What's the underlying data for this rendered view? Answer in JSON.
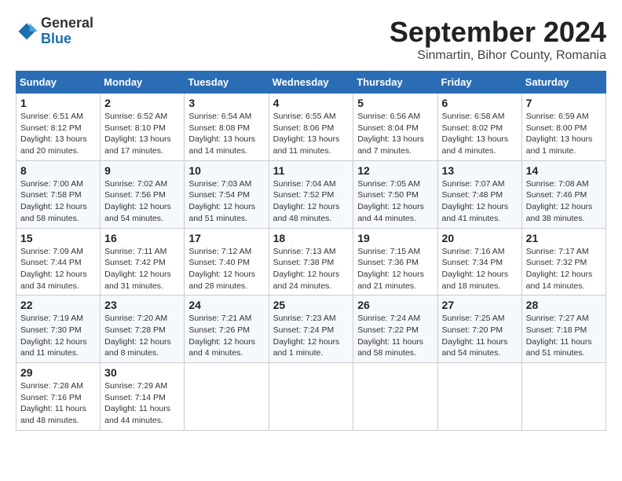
{
  "header": {
    "logo_general": "General",
    "logo_blue": "Blue",
    "month_title": "September 2024",
    "subtitle": "Sinmartin, Bihor County, Romania"
  },
  "days_of_week": [
    "Sunday",
    "Monday",
    "Tuesday",
    "Wednesday",
    "Thursday",
    "Friday",
    "Saturday"
  ],
  "weeks": [
    [
      {
        "day": "1",
        "info": "Sunrise: 6:51 AM\nSunset: 8:12 PM\nDaylight: 13 hours and 20 minutes."
      },
      {
        "day": "2",
        "info": "Sunrise: 6:52 AM\nSunset: 8:10 PM\nDaylight: 13 hours and 17 minutes."
      },
      {
        "day": "3",
        "info": "Sunrise: 6:54 AM\nSunset: 8:08 PM\nDaylight: 13 hours and 14 minutes."
      },
      {
        "day": "4",
        "info": "Sunrise: 6:55 AM\nSunset: 8:06 PM\nDaylight: 13 hours and 11 minutes."
      },
      {
        "day": "5",
        "info": "Sunrise: 6:56 AM\nSunset: 8:04 PM\nDaylight: 13 hours and 7 minutes."
      },
      {
        "day": "6",
        "info": "Sunrise: 6:58 AM\nSunset: 8:02 PM\nDaylight: 13 hours and 4 minutes."
      },
      {
        "day": "7",
        "info": "Sunrise: 6:59 AM\nSunset: 8:00 PM\nDaylight: 13 hours and 1 minute."
      }
    ],
    [
      {
        "day": "8",
        "info": "Sunrise: 7:00 AM\nSunset: 7:58 PM\nDaylight: 12 hours and 58 minutes."
      },
      {
        "day": "9",
        "info": "Sunrise: 7:02 AM\nSunset: 7:56 PM\nDaylight: 12 hours and 54 minutes."
      },
      {
        "day": "10",
        "info": "Sunrise: 7:03 AM\nSunset: 7:54 PM\nDaylight: 12 hours and 51 minutes."
      },
      {
        "day": "11",
        "info": "Sunrise: 7:04 AM\nSunset: 7:52 PM\nDaylight: 12 hours and 48 minutes."
      },
      {
        "day": "12",
        "info": "Sunrise: 7:05 AM\nSunset: 7:50 PM\nDaylight: 12 hours and 44 minutes."
      },
      {
        "day": "13",
        "info": "Sunrise: 7:07 AM\nSunset: 7:48 PM\nDaylight: 12 hours and 41 minutes."
      },
      {
        "day": "14",
        "info": "Sunrise: 7:08 AM\nSunset: 7:46 PM\nDaylight: 12 hours and 38 minutes."
      }
    ],
    [
      {
        "day": "15",
        "info": "Sunrise: 7:09 AM\nSunset: 7:44 PM\nDaylight: 12 hours and 34 minutes."
      },
      {
        "day": "16",
        "info": "Sunrise: 7:11 AM\nSunset: 7:42 PM\nDaylight: 12 hours and 31 minutes."
      },
      {
        "day": "17",
        "info": "Sunrise: 7:12 AM\nSunset: 7:40 PM\nDaylight: 12 hours and 28 minutes."
      },
      {
        "day": "18",
        "info": "Sunrise: 7:13 AM\nSunset: 7:38 PM\nDaylight: 12 hours and 24 minutes."
      },
      {
        "day": "19",
        "info": "Sunrise: 7:15 AM\nSunset: 7:36 PM\nDaylight: 12 hours and 21 minutes."
      },
      {
        "day": "20",
        "info": "Sunrise: 7:16 AM\nSunset: 7:34 PM\nDaylight: 12 hours and 18 minutes."
      },
      {
        "day": "21",
        "info": "Sunrise: 7:17 AM\nSunset: 7:32 PM\nDaylight: 12 hours and 14 minutes."
      }
    ],
    [
      {
        "day": "22",
        "info": "Sunrise: 7:19 AM\nSunset: 7:30 PM\nDaylight: 12 hours and 11 minutes."
      },
      {
        "day": "23",
        "info": "Sunrise: 7:20 AM\nSunset: 7:28 PM\nDaylight: 12 hours and 8 minutes."
      },
      {
        "day": "24",
        "info": "Sunrise: 7:21 AM\nSunset: 7:26 PM\nDaylight: 12 hours and 4 minutes."
      },
      {
        "day": "25",
        "info": "Sunrise: 7:23 AM\nSunset: 7:24 PM\nDaylight: 12 hours and 1 minute."
      },
      {
        "day": "26",
        "info": "Sunrise: 7:24 AM\nSunset: 7:22 PM\nDaylight: 11 hours and 58 minutes."
      },
      {
        "day": "27",
        "info": "Sunrise: 7:25 AM\nSunset: 7:20 PM\nDaylight: 11 hours and 54 minutes."
      },
      {
        "day": "28",
        "info": "Sunrise: 7:27 AM\nSunset: 7:18 PM\nDaylight: 11 hours and 51 minutes."
      }
    ],
    [
      {
        "day": "29",
        "info": "Sunrise: 7:28 AM\nSunset: 7:16 PM\nDaylight: 11 hours and 48 minutes."
      },
      {
        "day": "30",
        "info": "Sunrise: 7:29 AM\nSunset: 7:14 PM\nDaylight: 11 hours and 44 minutes."
      },
      null,
      null,
      null,
      null,
      null
    ]
  ]
}
